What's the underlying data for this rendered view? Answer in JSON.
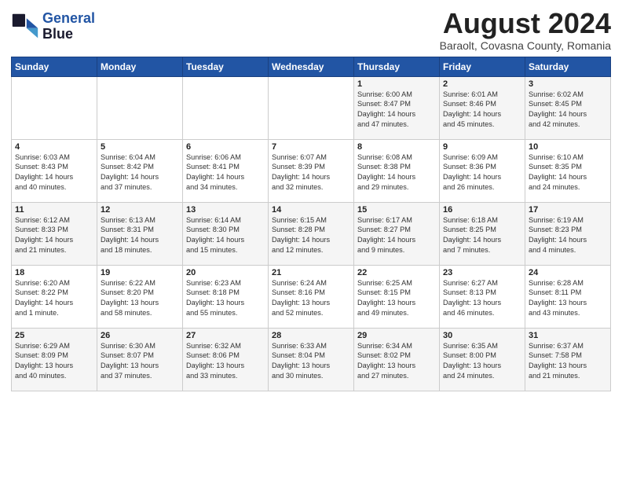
{
  "logo": {
    "line1": "General",
    "line2": "Blue"
  },
  "title": "August 2024",
  "subtitle": "Baraolt, Covasna County, Romania",
  "weekdays": [
    "Sunday",
    "Monday",
    "Tuesday",
    "Wednesday",
    "Thursday",
    "Friday",
    "Saturday"
  ],
  "weeks": [
    [
      {
        "day": "",
        "info": ""
      },
      {
        "day": "",
        "info": ""
      },
      {
        "day": "",
        "info": ""
      },
      {
        "day": "",
        "info": ""
      },
      {
        "day": "1",
        "info": "Sunrise: 6:00 AM\nSunset: 8:47 PM\nDaylight: 14 hours\nand 47 minutes."
      },
      {
        "day": "2",
        "info": "Sunrise: 6:01 AM\nSunset: 8:46 PM\nDaylight: 14 hours\nand 45 minutes."
      },
      {
        "day": "3",
        "info": "Sunrise: 6:02 AM\nSunset: 8:45 PM\nDaylight: 14 hours\nand 42 minutes."
      }
    ],
    [
      {
        "day": "4",
        "info": "Sunrise: 6:03 AM\nSunset: 8:43 PM\nDaylight: 14 hours\nand 40 minutes."
      },
      {
        "day": "5",
        "info": "Sunrise: 6:04 AM\nSunset: 8:42 PM\nDaylight: 14 hours\nand 37 minutes."
      },
      {
        "day": "6",
        "info": "Sunrise: 6:06 AM\nSunset: 8:41 PM\nDaylight: 14 hours\nand 34 minutes."
      },
      {
        "day": "7",
        "info": "Sunrise: 6:07 AM\nSunset: 8:39 PM\nDaylight: 14 hours\nand 32 minutes."
      },
      {
        "day": "8",
        "info": "Sunrise: 6:08 AM\nSunset: 8:38 PM\nDaylight: 14 hours\nand 29 minutes."
      },
      {
        "day": "9",
        "info": "Sunrise: 6:09 AM\nSunset: 8:36 PM\nDaylight: 14 hours\nand 26 minutes."
      },
      {
        "day": "10",
        "info": "Sunrise: 6:10 AM\nSunset: 8:35 PM\nDaylight: 14 hours\nand 24 minutes."
      }
    ],
    [
      {
        "day": "11",
        "info": "Sunrise: 6:12 AM\nSunset: 8:33 PM\nDaylight: 14 hours\nand 21 minutes."
      },
      {
        "day": "12",
        "info": "Sunrise: 6:13 AM\nSunset: 8:31 PM\nDaylight: 14 hours\nand 18 minutes."
      },
      {
        "day": "13",
        "info": "Sunrise: 6:14 AM\nSunset: 8:30 PM\nDaylight: 14 hours\nand 15 minutes."
      },
      {
        "day": "14",
        "info": "Sunrise: 6:15 AM\nSunset: 8:28 PM\nDaylight: 14 hours\nand 12 minutes."
      },
      {
        "day": "15",
        "info": "Sunrise: 6:17 AM\nSunset: 8:27 PM\nDaylight: 14 hours\nand 9 minutes."
      },
      {
        "day": "16",
        "info": "Sunrise: 6:18 AM\nSunset: 8:25 PM\nDaylight: 14 hours\nand 7 minutes."
      },
      {
        "day": "17",
        "info": "Sunrise: 6:19 AM\nSunset: 8:23 PM\nDaylight: 14 hours\nand 4 minutes."
      }
    ],
    [
      {
        "day": "18",
        "info": "Sunrise: 6:20 AM\nSunset: 8:22 PM\nDaylight: 14 hours\nand 1 minute."
      },
      {
        "day": "19",
        "info": "Sunrise: 6:22 AM\nSunset: 8:20 PM\nDaylight: 13 hours\nand 58 minutes."
      },
      {
        "day": "20",
        "info": "Sunrise: 6:23 AM\nSunset: 8:18 PM\nDaylight: 13 hours\nand 55 minutes."
      },
      {
        "day": "21",
        "info": "Sunrise: 6:24 AM\nSunset: 8:16 PM\nDaylight: 13 hours\nand 52 minutes."
      },
      {
        "day": "22",
        "info": "Sunrise: 6:25 AM\nSunset: 8:15 PM\nDaylight: 13 hours\nand 49 minutes."
      },
      {
        "day": "23",
        "info": "Sunrise: 6:27 AM\nSunset: 8:13 PM\nDaylight: 13 hours\nand 46 minutes."
      },
      {
        "day": "24",
        "info": "Sunrise: 6:28 AM\nSunset: 8:11 PM\nDaylight: 13 hours\nand 43 minutes."
      }
    ],
    [
      {
        "day": "25",
        "info": "Sunrise: 6:29 AM\nSunset: 8:09 PM\nDaylight: 13 hours\nand 40 minutes."
      },
      {
        "day": "26",
        "info": "Sunrise: 6:30 AM\nSunset: 8:07 PM\nDaylight: 13 hours\nand 37 minutes."
      },
      {
        "day": "27",
        "info": "Sunrise: 6:32 AM\nSunset: 8:06 PM\nDaylight: 13 hours\nand 33 minutes."
      },
      {
        "day": "28",
        "info": "Sunrise: 6:33 AM\nSunset: 8:04 PM\nDaylight: 13 hours\nand 30 minutes."
      },
      {
        "day": "29",
        "info": "Sunrise: 6:34 AM\nSunset: 8:02 PM\nDaylight: 13 hours\nand 27 minutes."
      },
      {
        "day": "30",
        "info": "Sunrise: 6:35 AM\nSunset: 8:00 PM\nDaylight: 13 hours\nand 24 minutes."
      },
      {
        "day": "31",
        "info": "Sunrise: 6:37 AM\nSunset: 7:58 PM\nDaylight: 13 hours\nand 21 minutes."
      }
    ]
  ]
}
